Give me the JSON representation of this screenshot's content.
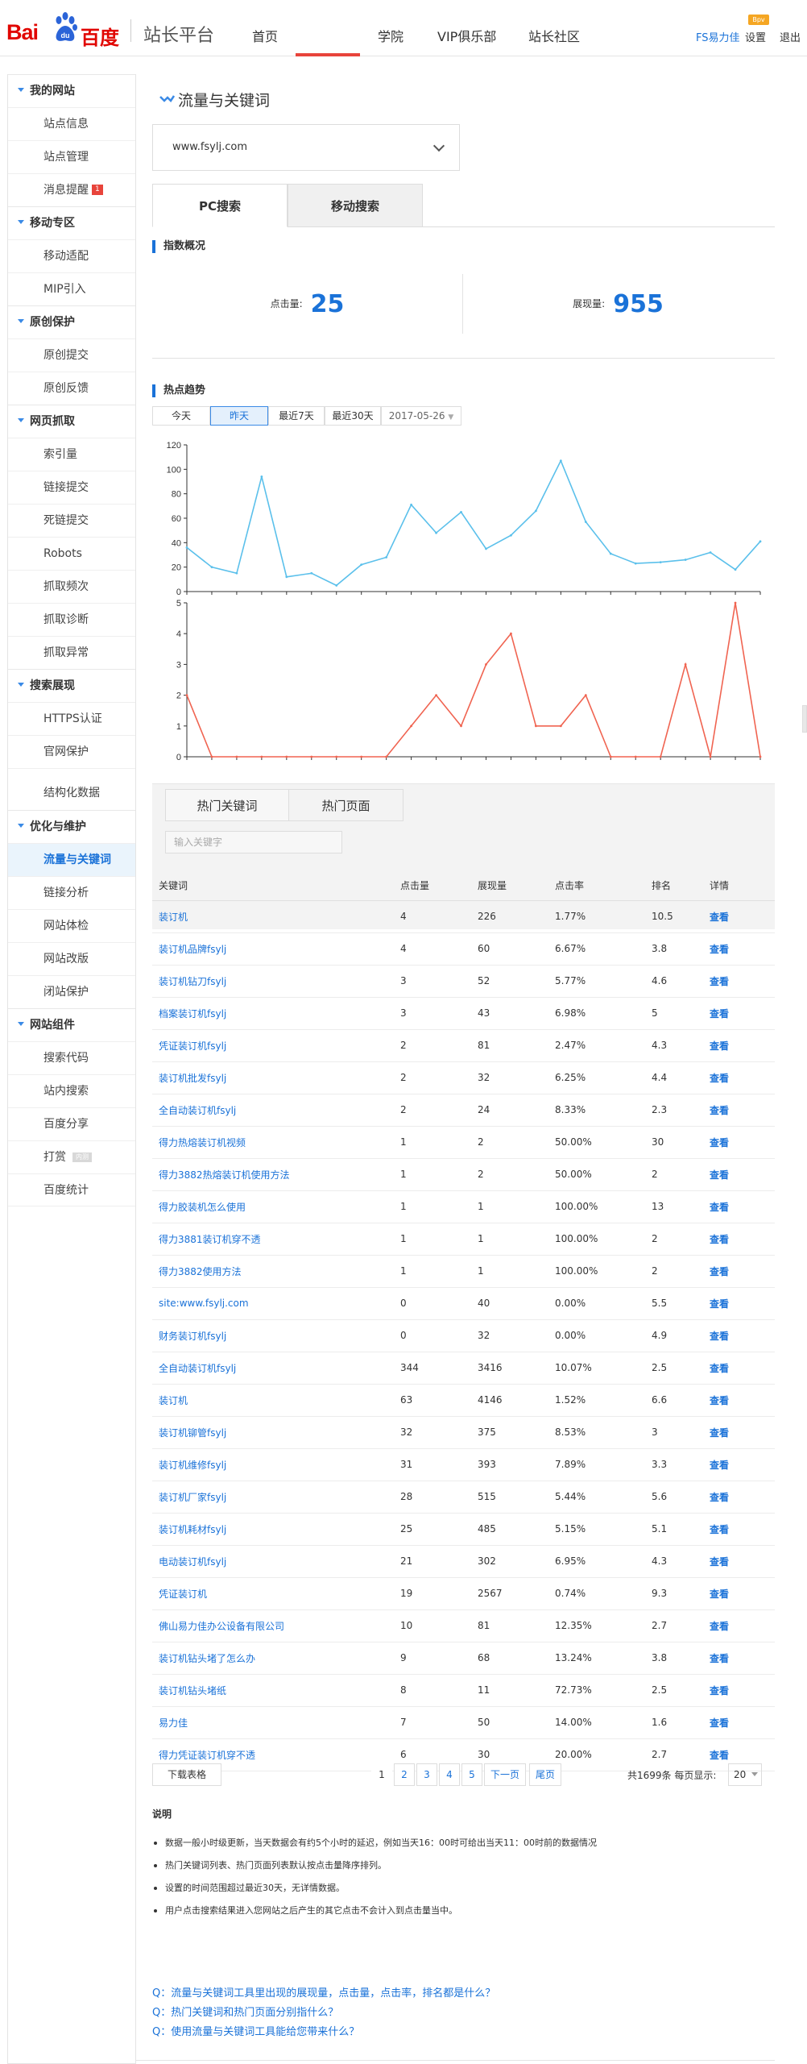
{
  "header": {
    "logo_bai": "Bai",
    "logo_du": "百度",
    "platform": "站长平台",
    "nav": [
      "首页",
      "",
      "学院",
      "VIP俱乐部",
      "站长社区"
    ],
    "user": "FS易力佳",
    "settings": "设置",
    "logout": "退出",
    "vip_badge": "Bpv"
  },
  "sidebar": {
    "groups": [
      {
        "title": "我的网站",
        "items": [
          "站点信息",
          "站点管理",
          "消息提醒"
        ]
      },
      {
        "title": "移动专区",
        "items": [
          "移动适配",
          "MIP引入"
        ]
      },
      {
        "title": "原创保护",
        "items": [
          "原创提交",
          "原创反馈"
        ]
      },
      {
        "title": "网页抓取",
        "items": [
          "索引量",
          "链接提交",
          "死链提交",
          "Robots",
          "抓取频次",
          "抓取诊断",
          "抓取异常"
        ]
      },
      {
        "title": "搜索展现",
        "items": [
          "HTTPS认证",
          "官网保护",
          "结构化数据"
        ]
      },
      {
        "title": "优化与维护",
        "items": [
          "流量与关键词",
          "链接分析",
          "网站体检",
          "网站改版",
          "闭站保护"
        ]
      },
      {
        "title": "网站组件",
        "items": [
          "搜索代码",
          "站内搜索",
          "百度分享",
          "打赏",
          "百度统计"
        ]
      }
    ],
    "msg_badge": "1",
    "new_badge": "内测"
  },
  "main": {
    "title": "流量与关键词",
    "site": "www.fsylj.com",
    "tabs": [
      "PC搜索",
      "移动搜索"
    ],
    "overview_title": "指数概况",
    "clicks_label": "点击量:",
    "clicks": "25",
    "impressions_label": "展现量:",
    "impressions": "955",
    "trend_title": "热点趋势",
    "filters": [
      "今天",
      "昨天",
      "最近7天",
      "最近30天",
      "2017-05-26"
    ],
    "kw_tabs": [
      "热门关键词",
      "热门页面"
    ],
    "search_placeholder": "输入关键字",
    "table_headers": [
      "关键词",
      "点击量",
      "展现量",
      "点击率",
      "排名",
      "详情"
    ],
    "rows": [
      [
        "装订机",
        "4",
        "226",
        "1.77%",
        "10.5",
        "查看"
      ],
      [
        "装订机品牌fsylj",
        "4",
        "60",
        "6.67%",
        "3.8",
        "查看"
      ],
      [
        "装订机钻刀fsylj",
        "3",
        "52",
        "5.77%",
        "4.6",
        "查看"
      ],
      [
        "档案装订机fsylj",
        "3",
        "43",
        "6.98%",
        "5",
        "查看"
      ],
      [
        "凭证装订机fsylj",
        "2",
        "81",
        "2.47%",
        "4.3",
        "查看"
      ],
      [
        "装订机批发fsylj",
        "2",
        "32",
        "6.25%",
        "4.4",
        "查看"
      ],
      [
        "全自动装订机fsylj",
        "2",
        "24",
        "8.33%",
        "2.3",
        "查看"
      ],
      [
        "得力热熔装订机视频",
        "1",
        "2",
        "50.00%",
        "30",
        "查看"
      ],
      [
        "得力3882热熔装订机使用方法",
        "1",
        "2",
        "50.00%",
        "2",
        "查看"
      ],
      [
        "得力胶装机怎么使用",
        "1",
        "1",
        "100.00%",
        "13",
        "查看"
      ],
      [
        "得力3881装订机穿不透",
        "1",
        "1",
        "100.00%",
        "2",
        "查看"
      ],
      [
        "得力3882使用方法",
        "1",
        "1",
        "100.00%",
        "2",
        "查看"
      ],
      [
        "site:www.fsylj.com",
        "0",
        "40",
        "0.00%",
        "5.5",
        "查看"
      ],
      [
        "财务装订机fsylj",
        "0",
        "32",
        "0.00%",
        "4.9",
        "查看"
      ],
      [
        "全自动装订机fsylj",
        "344",
        "3416",
        "10.07%",
        "2.5",
        "查看"
      ],
      [
        "装订机",
        "63",
        "4146",
        "1.52%",
        "6.6",
        "查看"
      ],
      [
        "装订机铆管fsylj",
        "32",
        "375",
        "8.53%",
        "3",
        "查看"
      ],
      [
        "装订机维修fsylj",
        "31",
        "393",
        "7.89%",
        "3.3",
        "查看"
      ],
      [
        "装订机厂家fsylj",
        "28",
        "515",
        "5.44%",
        "5.6",
        "查看"
      ],
      [
        "装订机耗材fsylj",
        "25",
        "485",
        "5.15%",
        "5.1",
        "查看"
      ],
      [
        "电动装订机fsylj",
        "21",
        "302",
        "6.95%",
        "4.3",
        "查看"
      ],
      [
        "凭证装订机",
        "19",
        "2567",
        "0.74%",
        "9.3",
        "查看"
      ],
      [
        "佛山易力佳办公设备有限公司",
        "10",
        "81",
        "12.35%",
        "2.7",
        "查看"
      ],
      [
        "装订机钻头堵了怎么办",
        "9",
        "68",
        "13.24%",
        "3.8",
        "查看"
      ],
      [
        "装订机钻头堵纸",
        "8",
        "11",
        "72.73%",
        "2.5",
        "查看"
      ],
      [
        "易力佳",
        "7",
        "50",
        "14.00%",
        "1.6",
        "查看"
      ],
      [
        "得力凭证装订机穿不透",
        "6",
        "30",
        "20.00%",
        "2.7",
        "查看"
      ]
    ],
    "download": "下载表格",
    "pages": [
      "1",
      "2",
      "3",
      "4",
      "5",
      "下一页",
      "尾页"
    ],
    "total": "共1699条  每页显示:",
    "per_page": "20",
    "notes_title": "说明",
    "notes": [
      "数据一般小时级更新，当天数据会有约5个小时的延迟，例如当天16：00时可给出当天11：00时前的数据情况",
      "热门关键词列表、热门页面列表默认按点击量降序排列。",
      "设置的时间范围超过最近30天，无详情数据。",
      "用户点击搜索结果进入您网站之后产生的其它点击不会计入到点击量当中。"
    ],
    "faqs": [
      "Q：流量与关键词工具里出现的展现量，点击量，点击率，排名都是什么？",
      "Q：热门关键词和热门页面分别指什么？",
      "Q：使用流量与关键词工具能给您带来什么？"
    ]
  },
  "chart_data": [
    {
      "type": "line",
      "title": "",
      "series": [
        {
          "name": "",
          "color": "#5bc0eb",
          "values": [
            36,
            20,
            15,
            94,
            12,
            15,
            5,
            22,
            28,
            71,
            48,
            65,
            35,
            46,
            66,
            107,
            57,
            31,
            23,
            24,
            26,
            32,
            18,
            41
          ]
        }
      ],
      "ylim": [
        0,
        120
      ],
      "yticks": [
        0,
        20,
        40,
        60,
        80,
        100,
        120
      ],
      "grid": false
    },
    {
      "type": "line",
      "title": "",
      "series": [
        {
          "name": "",
          "color": "#f06451",
          "values": [
            2,
            0,
            0,
            0,
            0,
            0,
            0,
            0,
            0,
            1,
            2,
            1,
            3,
            4,
            1,
            1,
            2,
            0,
            0,
            0,
            3,
            0,
            5,
            0
          ]
        }
      ],
      "ylim": [
        0,
        5
      ],
      "yticks": [
        0,
        1,
        2,
        3,
        4,
        5
      ],
      "grid": false
    }
  ]
}
